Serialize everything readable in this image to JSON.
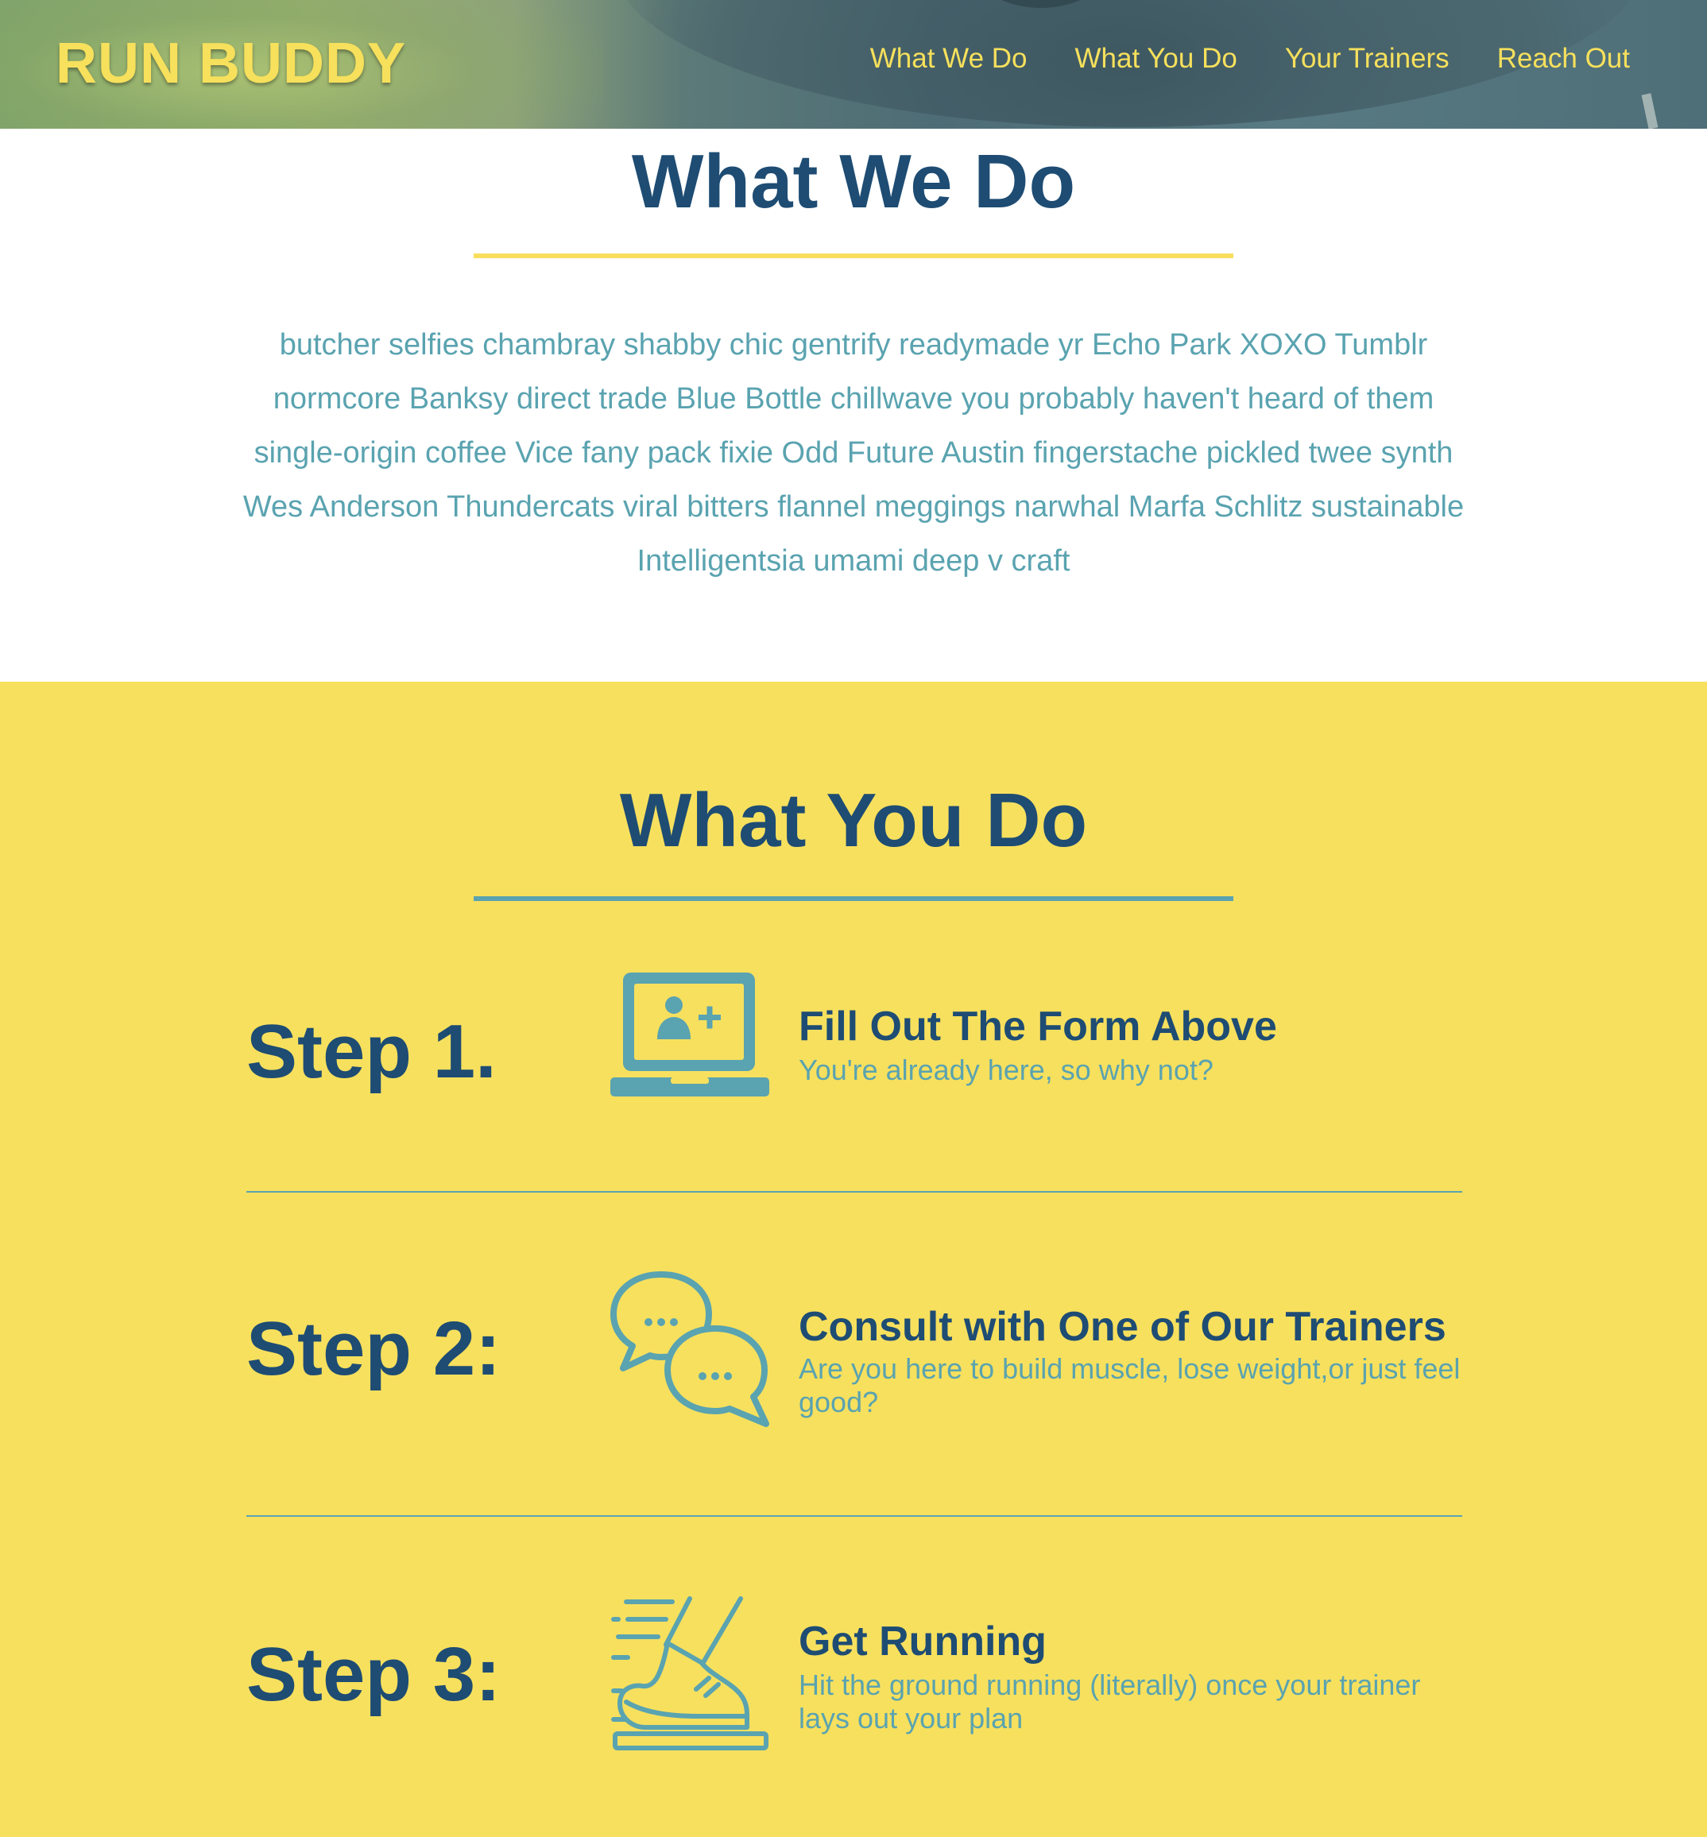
{
  "header": {
    "brand": "RUN BUDDY",
    "nav": [
      {
        "label": "What We Do"
      },
      {
        "label": "What You Do"
      },
      {
        "label": "Your Trainers"
      },
      {
        "label": "Reach Out"
      }
    ]
  },
  "what_we_do": {
    "title": "What We Do",
    "body": "butcher selfies chambray shabby chic gentrify readymade yr Echo Park XOXO Tumblr normcore Banksy direct trade Blue Bottle chillwave you probably haven't heard of them single-origin coffee Vice fany pack fixie Odd Future Austin fingerstache pickled twee synth Wes Anderson Thundercats viral bitters flannel meggings narwhal Marfa Schlitz sustainable Intelligentsia umami deep v craft"
  },
  "what_you_do": {
    "title": "What You Do",
    "steps": [
      {
        "label": "Step 1.",
        "icon": "laptop-add-user-icon",
        "title": "Fill Out The Form Above",
        "description": "You're already here, so why not?"
      },
      {
        "label": "Step 2:",
        "icon": "chat-bubbles-icon",
        "title": "Consult with One of Our Trainers",
        "description": "Are you here to build muscle, lose weight,or just feel good?"
      },
      {
        "label": "Step 3:",
        "icon": "running-shoe-icon",
        "title": "Get Running",
        "description": "Hit the ground running (literally) once your trainer lays out your plan"
      }
    ]
  },
  "colors": {
    "navy": "#1e4c73",
    "teal": "#5aa3b0",
    "yellow": "#f7e05e"
  }
}
